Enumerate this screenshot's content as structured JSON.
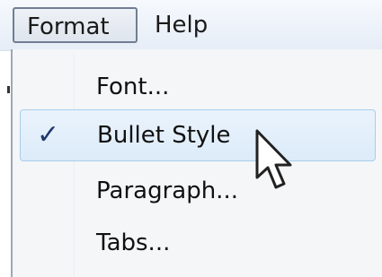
{
  "menubar": {
    "items": [
      {
        "label": "Format"
      },
      {
        "label": "Help"
      }
    ]
  },
  "menu": {
    "items": [
      {
        "label": "Font...",
        "checked": false
      },
      {
        "label": "Bullet Style",
        "checked": true,
        "highlighted": true
      },
      {
        "label": "Paragraph...",
        "checked": false
      },
      {
        "label": "Tabs...",
        "checked": false
      }
    ],
    "check_glyph": "✓"
  },
  "colors": {
    "highlight_border": "#a8cdea",
    "highlight_fill": "#dcebf9",
    "check_color": "#1f3b6b"
  },
  "icons": {
    "checkmark": "check-icon",
    "pointer": "mouse-pointer-icon"
  }
}
